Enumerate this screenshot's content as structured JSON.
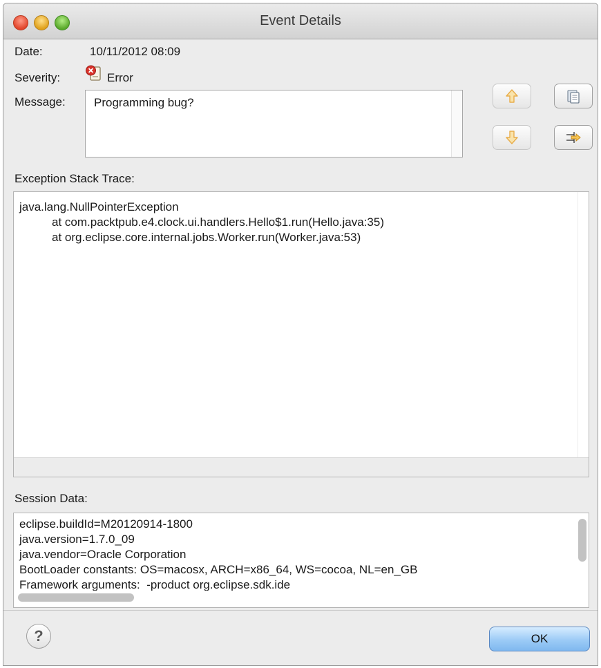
{
  "window": {
    "title": "Event Details"
  },
  "details": {
    "date_label": "Date:",
    "date_value": "10/11/2012 08:09",
    "severity_label": "Severity:",
    "severity_value": "Error",
    "severity_icon": "error-icon",
    "message_label": "Message:",
    "message_value": "Programming bug?"
  },
  "toolbar": {
    "previous_icon": "arrow-up-icon",
    "next_icon": "arrow-down-icon",
    "copy_icon": "clipboard-icon",
    "filter_icon": "filter-icon"
  },
  "stack_trace": {
    "label": "Exception Stack Trace:",
    "lines": [
      "java.lang.NullPointerException",
      "at com.packtpub.e4.clock.ui.handlers.Hello$1.run(Hello.java:35)",
      "at org.eclipse.core.internal.jobs.Worker.run(Worker.java:53)"
    ]
  },
  "session": {
    "label": "Session Data:",
    "lines": [
      "eclipse.buildId=M20120914-1800",
      "java.version=1.7.0_09",
      "java.vendor=Oracle Corporation",
      "BootLoader constants: OS=macosx, ARCH=x86_64, WS=cocoa, NL=en_GB",
      "Framework arguments:  -product org.eclipse.sdk.ide"
    ]
  },
  "footer": {
    "help_label": "?",
    "ok_label": "OK"
  },
  "colors": {
    "error_red": "#d8322a",
    "arrow_orange": "#f0a830",
    "ok_blue": "#9ccbf6"
  }
}
